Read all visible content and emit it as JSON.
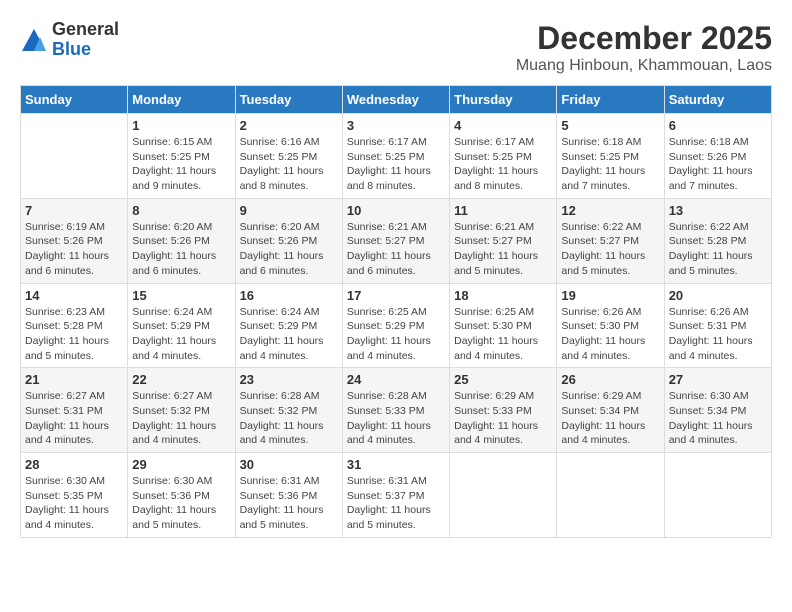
{
  "logo": {
    "general": "General",
    "blue": "Blue"
  },
  "title": "December 2025",
  "location": "Muang Hinboun, Khammouan, Laos",
  "days_of_week": [
    "Sunday",
    "Monday",
    "Tuesday",
    "Wednesday",
    "Thursday",
    "Friday",
    "Saturday"
  ],
  "weeks": [
    [
      {
        "day": "",
        "info": ""
      },
      {
        "day": "1",
        "info": "Sunrise: 6:15 AM\nSunset: 5:25 PM\nDaylight: 11 hours\nand 9 minutes."
      },
      {
        "day": "2",
        "info": "Sunrise: 6:16 AM\nSunset: 5:25 PM\nDaylight: 11 hours\nand 8 minutes."
      },
      {
        "day": "3",
        "info": "Sunrise: 6:17 AM\nSunset: 5:25 PM\nDaylight: 11 hours\nand 8 minutes."
      },
      {
        "day": "4",
        "info": "Sunrise: 6:17 AM\nSunset: 5:25 PM\nDaylight: 11 hours\nand 8 minutes."
      },
      {
        "day": "5",
        "info": "Sunrise: 6:18 AM\nSunset: 5:25 PM\nDaylight: 11 hours\nand 7 minutes."
      },
      {
        "day": "6",
        "info": "Sunrise: 6:18 AM\nSunset: 5:26 PM\nDaylight: 11 hours\nand 7 minutes."
      }
    ],
    [
      {
        "day": "7",
        "info": "Sunrise: 6:19 AM\nSunset: 5:26 PM\nDaylight: 11 hours\nand 6 minutes."
      },
      {
        "day": "8",
        "info": "Sunrise: 6:20 AM\nSunset: 5:26 PM\nDaylight: 11 hours\nand 6 minutes."
      },
      {
        "day": "9",
        "info": "Sunrise: 6:20 AM\nSunset: 5:26 PM\nDaylight: 11 hours\nand 6 minutes."
      },
      {
        "day": "10",
        "info": "Sunrise: 6:21 AM\nSunset: 5:27 PM\nDaylight: 11 hours\nand 6 minutes."
      },
      {
        "day": "11",
        "info": "Sunrise: 6:21 AM\nSunset: 5:27 PM\nDaylight: 11 hours\nand 5 minutes."
      },
      {
        "day": "12",
        "info": "Sunrise: 6:22 AM\nSunset: 5:27 PM\nDaylight: 11 hours\nand 5 minutes."
      },
      {
        "day": "13",
        "info": "Sunrise: 6:22 AM\nSunset: 5:28 PM\nDaylight: 11 hours\nand 5 minutes."
      }
    ],
    [
      {
        "day": "14",
        "info": "Sunrise: 6:23 AM\nSunset: 5:28 PM\nDaylight: 11 hours\nand 5 minutes."
      },
      {
        "day": "15",
        "info": "Sunrise: 6:24 AM\nSunset: 5:29 PM\nDaylight: 11 hours\nand 4 minutes."
      },
      {
        "day": "16",
        "info": "Sunrise: 6:24 AM\nSunset: 5:29 PM\nDaylight: 11 hours\nand 4 minutes."
      },
      {
        "day": "17",
        "info": "Sunrise: 6:25 AM\nSunset: 5:29 PM\nDaylight: 11 hours\nand 4 minutes."
      },
      {
        "day": "18",
        "info": "Sunrise: 6:25 AM\nSunset: 5:30 PM\nDaylight: 11 hours\nand 4 minutes."
      },
      {
        "day": "19",
        "info": "Sunrise: 6:26 AM\nSunset: 5:30 PM\nDaylight: 11 hours\nand 4 minutes."
      },
      {
        "day": "20",
        "info": "Sunrise: 6:26 AM\nSunset: 5:31 PM\nDaylight: 11 hours\nand 4 minutes."
      }
    ],
    [
      {
        "day": "21",
        "info": "Sunrise: 6:27 AM\nSunset: 5:31 PM\nDaylight: 11 hours\nand 4 minutes."
      },
      {
        "day": "22",
        "info": "Sunrise: 6:27 AM\nSunset: 5:32 PM\nDaylight: 11 hours\nand 4 minutes."
      },
      {
        "day": "23",
        "info": "Sunrise: 6:28 AM\nSunset: 5:32 PM\nDaylight: 11 hours\nand 4 minutes."
      },
      {
        "day": "24",
        "info": "Sunrise: 6:28 AM\nSunset: 5:33 PM\nDaylight: 11 hours\nand 4 minutes."
      },
      {
        "day": "25",
        "info": "Sunrise: 6:29 AM\nSunset: 5:33 PM\nDaylight: 11 hours\nand 4 minutes."
      },
      {
        "day": "26",
        "info": "Sunrise: 6:29 AM\nSunset: 5:34 PM\nDaylight: 11 hours\nand 4 minutes."
      },
      {
        "day": "27",
        "info": "Sunrise: 6:30 AM\nSunset: 5:34 PM\nDaylight: 11 hours\nand 4 minutes."
      }
    ],
    [
      {
        "day": "28",
        "info": "Sunrise: 6:30 AM\nSunset: 5:35 PM\nDaylight: 11 hours\nand 4 minutes."
      },
      {
        "day": "29",
        "info": "Sunrise: 6:30 AM\nSunset: 5:36 PM\nDaylight: 11 hours\nand 5 minutes."
      },
      {
        "day": "30",
        "info": "Sunrise: 6:31 AM\nSunset: 5:36 PM\nDaylight: 11 hours\nand 5 minutes."
      },
      {
        "day": "31",
        "info": "Sunrise: 6:31 AM\nSunset: 5:37 PM\nDaylight: 11 hours\nand 5 minutes."
      },
      {
        "day": "",
        "info": ""
      },
      {
        "day": "",
        "info": ""
      },
      {
        "day": "",
        "info": ""
      }
    ]
  ]
}
